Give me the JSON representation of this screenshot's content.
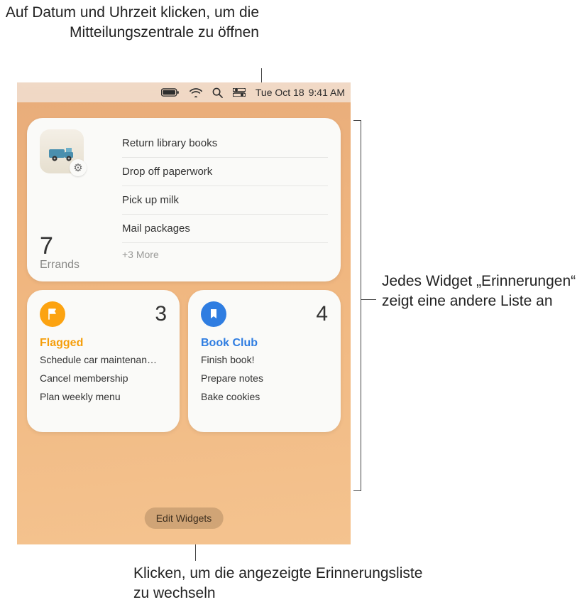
{
  "captions": {
    "top": "Auf Datum und Uhrzeit klicken, um die Mitteilungszentrale zu öffnen",
    "right": "Jedes Widget „Erinnerungen“ zeigt eine andere Liste an",
    "bottom": "Klicken, um die angezeigte Erinnerungsliste zu wechseln"
  },
  "menubar": {
    "date": "Tue Oct 18",
    "time": "9:41 AM"
  },
  "errands": {
    "title": "Errands",
    "count": "7",
    "items": [
      "Return library books",
      "Drop off paperwork",
      "Pick up milk",
      "Mail packages"
    ],
    "more": "+3 More"
  },
  "flagged": {
    "title": "Flagged",
    "count": "3",
    "items": [
      "Schedule car maintenan…",
      "Cancel membership",
      "Plan weekly menu"
    ]
  },
  "bookclub": {
    "title": "Book Club",
    "count": "4",
    "items": [
      "Finish book!",
      "Prepare notes",
      "Bake cookies"
    ]
  },
  "edit_widgets": "Edit Widgets"
}
